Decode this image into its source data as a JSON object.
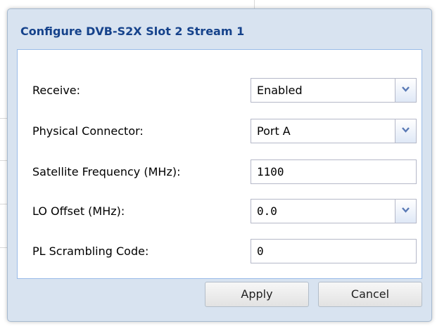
{
  "dialog": {
    "title": "Configure DVB-S2X Slot 2 Stream 1"
  },
  "form": {
    "receive": {
      "label": "Receive:",
      "value": "Enabled"
    },
    "physical_connector": {
      "label": "Physical Connector:",
      "value": "Port A"
    },
    "satellite_frequency": {
      "label": "Satellite Frequency (MHz):",
      "value": "1100"
    },
    "lo_offset": {
      "label": "LO Offset (MHz):",
      "value": "0.0"
    },
    "pl_scrambling_code": {
      "label": "PL Scrambling Code:",
      "value": "0"
    }
  },
  "buttons": {
    "apply_label": "Apply",
    "cancel_label": "Cancel"
  },
  "icons": {
    "dropdown": "chevron-down-icon"
  },
  "colors": {
    "title_text": "#15428b",
    "dialog_frame": "#d8e3f0",
    "panel_border": "#99bbe8",
    "chevron": "#5a7ab5"
  }
}
